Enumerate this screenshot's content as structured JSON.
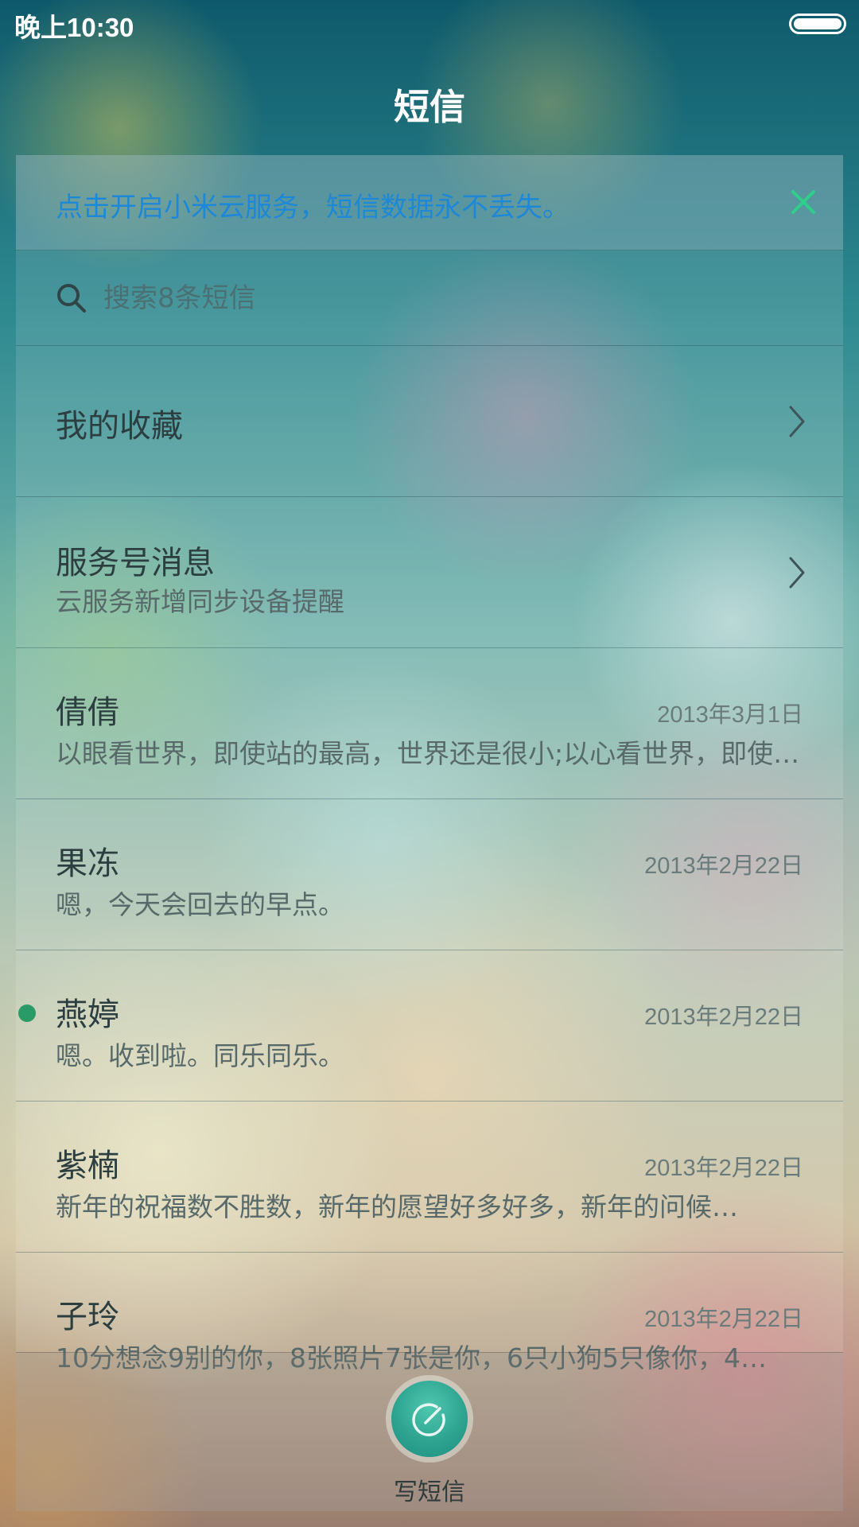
{
  "status_bar": {
    "time": "晚上10:30"
  },
  "header": {
    "title": "短信"
  },
  "cloud_banner": {
    "text": "点击开启小米云服务，短信数据永不丢失。"
  },
  "search": {
    "placeholder": "搜索8条短信"
  },
  "favorites": {
    "title": "我的收藏"
  },
  "service": {
    "title": "服务号消息",
    "subtitle": "云服务新增同步设备提醒"
  },
  "conversations": [
    {
      "name": "倩倩",
      "date": "2013年3月1日",
      "preview": "以眼看世界，即使站的最高，世界还是很小;以心看世界，即使站的最低，世界也是很大。",
      "unread": false
    },
    {
      "name": "果冻",
      "date": "2013年2月22日",
      "preview": "嗯，今天会回去的早点。",
      "unread": false
    },
    {
      "name": "燕婷",
      "date": "2013年2月22日",
      "preview": "嗯。收到啦。同乐同乐。",
      "unread": true
    },
    {
      "name": "紫楠",
      "date": "2013年2月22日",
      "preview": "新年的祝福数不胜数，新年的愿望好多好多，新年的问候…",
      "unread": false
    },
    {
      "name": "子玲",
      "date": "2013年2月22日",
      "preview": "10分想念9别的你，8张照片7张是你，6只小狗5只像你，4…",
      "unread": false
    }
  ],
  "compose": {
    "label": "写短信"
  },
  "colors": {
    "accent": "#1e88d8",
    "close": "#2ecf8a",
    "unread": "#2a9a67",
    "compose": "#2ea490"
  }
}
